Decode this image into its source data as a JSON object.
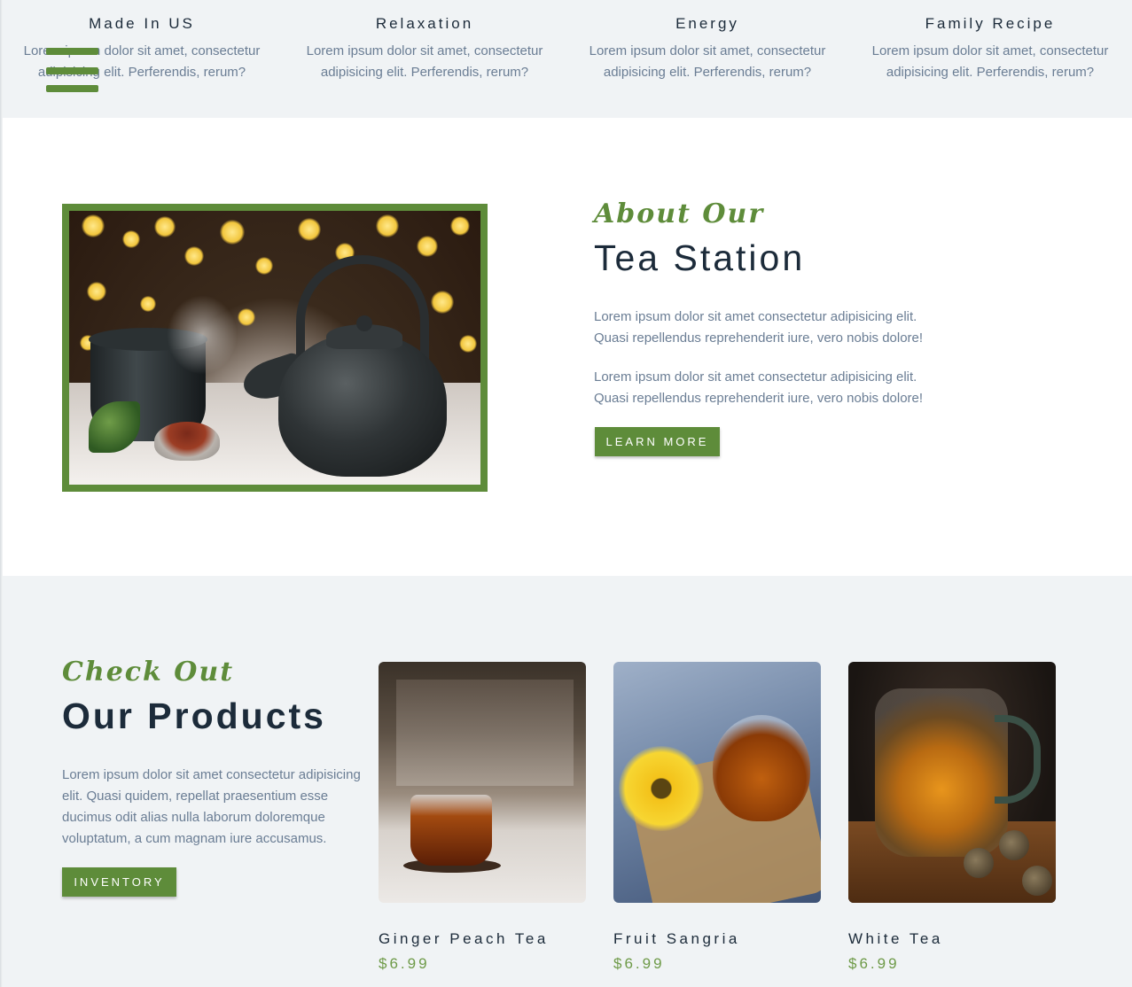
{
  "features": [
    {
      "title": "Made In US",
      "text": "Lorem ipsum dolor sit amet, consectetur adipisicing elit. Perferendis, rerum?"
    },
    {
      "title": "Relaxation",
      "text": "Lorem ipsum dolor sit amet, consectetur adipisicing elit. Perferendis, rerum?"
    },
    {
      "title": "Energy",
      "text": "Lorem ipsum dolor sit amet, consectetur adipisicing elit. Perferendis, rerum?"
    },
    {
      "title": "Family Recipe",
      "text": "Lorem ipsum dolor sit amet, consectetur adipisicing elit. Perferendis, rerum?"
    }
  ],
  "about": {
    "kicker": "About Our",
    "title": "Tea Station",
    "paragraphs": [
      "Lorem ipsum dolor sit amet consectetur adipisicing elit. Quasi repellendus reprehenderit iure, vero nobis dolore!",
      "Lorem ipsum dolor sit amet consectetur adipisicing elit. Quasi repellendus reprehenderit iure, vero nobis dolore!"
    ],
    "button_label": "LEARN MORE"
  },
  "products": {
    "kicker": "Check Out",
    "title": "Our Products",
    "description": "Lorem ipsum dolor sit amet consectetur adipisicing elit. Quasi quidem, repellat praesentium esse ducimus odit alias nulla laborum doloremque voluptatum, a cum magnam iure accusamus.",
    "button_label": "INVENTORY",
    "items": [
      {
        "name": "Ginger Peach Tea",
        "price": "$6.99"
      },
      {
        "name": "Fruit Sangria",
        "price": "$6.99"
      },
      {
        "name": "White Tea",
        "price": "$6.99"
      }
    ]
  },
  "colors": {
    "accent": "#5e8c3a",
    "heading": "#1c2b3a",
    "body_text": "#6a7d94",
    "section_bg": "#f0f3f5"
  },
  "icons": {
    "menu": "hamburger-menu-icon"
  }
}
